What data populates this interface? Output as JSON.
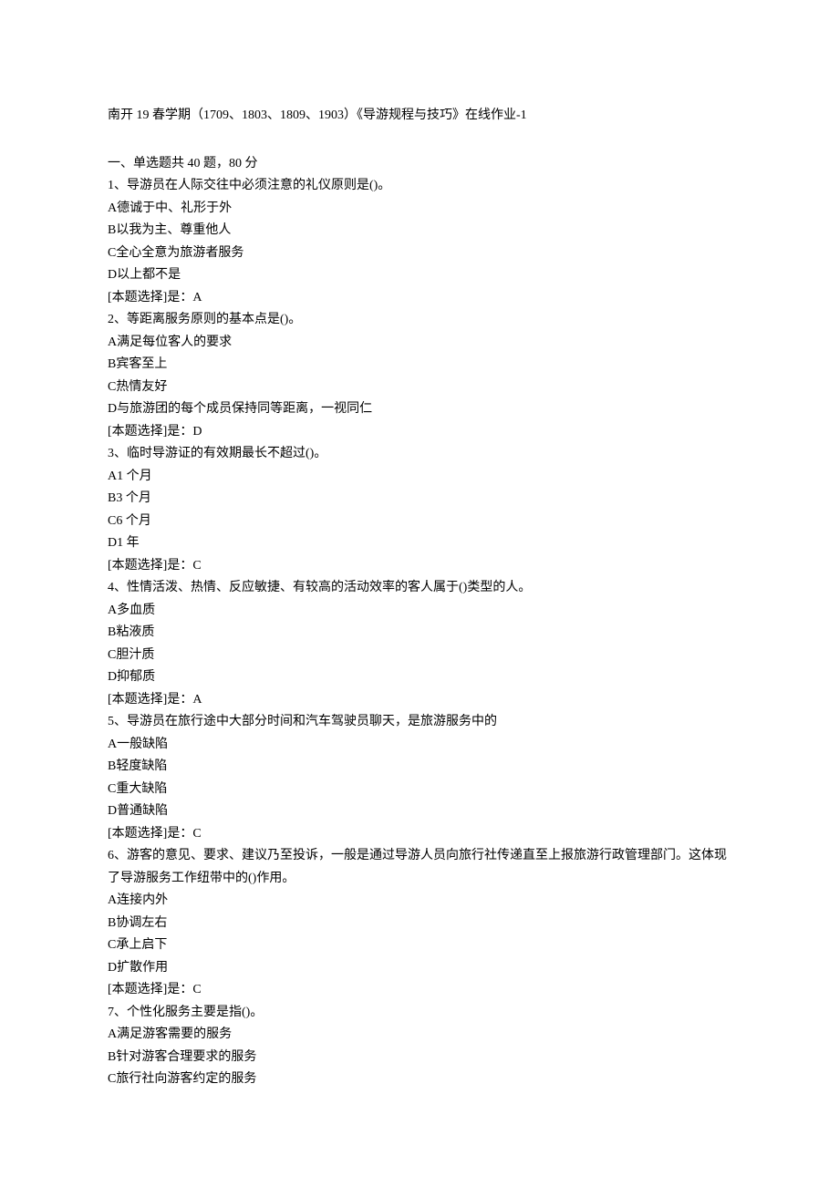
{
  "title": "南开 19 春学期（1709、1803、1809、1903）《导游规程与技巧》在线作业-1",
  "section_header": "一、单选题共 40 题，80 分",
  "answer_label_prefix": "[本题选择]是：",
  "questions": [
    {
      "num": "1",
      "stem": "导游员在人际交往中必须注意的礼仪原则是()。",
      "options": [
        {
          "letter": "A",
          "text": "德诚于中、礼形于外"
        },
        {
          "letter": "B",
          "text": "以我为主、尊重他人"
        },
        {
          "letter": "C",
          "text": "全心全意为旅游者服务"
        },
        {
          "letter": "D",
          "text": "以上都不是"
        }
      ],
      "answer": "A"
    },
    {
      "num": "2",
      "stem": "等距离服务原则的基本点是()。",
      "options": [
        {
          "letter": "A",
          "text": "满足每位客人的要求"
        },
        {
          "letter": "B",
          "text": "宾客至上"
        },
        {
          "letter": "C",
          "text": "热情友好"
        },
        {
          "letter": "D",
          "text": "与旅游团的每个成员保持同等距离，一视同仁"
        }
      ],
      "answer": "D"
    },
    {
      "num": "3",
      "stem": "临时导游证的有效期最长不超过()。",
      "options": [
        {
          "letter": "A",
          "text": "1 个月"
        },
        {
          "letter": "B",
          "text": "3 个月"
        },
        {
          "letter": "C",
          "text": "6 个月"
        },
        {
          "letter": "D",
          "text": "1 年"
        }
      ],
      "answer": "C"
    },
    {
      "num": "4",
      "stem": "性情活泼、热情、反应敏捷、有较高的活动效率的客人属于()类型的人。",
      "options": [
        {
          "letter": "A",
          "text": "多血质"
        },
        {
          "letter": "B",
          "text": "粘液质"
        },
        {
          "letter": "C",
          "text": "胆汁质"
        },
        {
          "letter": "D",
          "text": "抑郁质"
        }
      ],
      "answer": "A"
    },
    {
      "num": "5",
      "stem": "导游员在旅行途中大部分时间和汽车驾驶员聊天，是旅游服务中的",
      "options": [
        {
          "letter": "A",
          "text": "一般缺陷"
        },
        {
          "letter": "B",
          "text": "轻度缺陷"
        },
        {
          "letter": "C",
          "text": "重大缺陷"
        },
        {
          "letter": "D",
          "text": "普通缺陷"
        }
      ],
      "answer": "C"
    },
    {
      "num": "6",
      "stem": "游客的意见、要求、建议乃至投诉，一般是通过导游人员向旅行社传递直至上报旅游行政管理部门。这体现了导游服务工作纽带中的()作用。",
      "options": [
        {
          "letter": "A",
          "text": "连接内外"
        },
        {
          "letter": "B",
          "text": "协调左右"
        },
        {
          "letter": "C",
          "text": "承上启下"
        },
        {
          "letter": "D",
          "text": "扩散作用"
        }
      ],
      "answer": "C"
    },
    {
      "num": "7",
      "stem": "个性化服务主要是指()。",
      "options": [
        {
          "letter": "A",
          "text": "满足游客需要的服务"
        },
        {
          "letter": "B",
          "text": "针对游客合理要求的服务"
        },
        {
          "letter": "C",
          "text": "旅行社向游客约定的服务"
        }
      ],
      "answer": null
    }
  ]
}
